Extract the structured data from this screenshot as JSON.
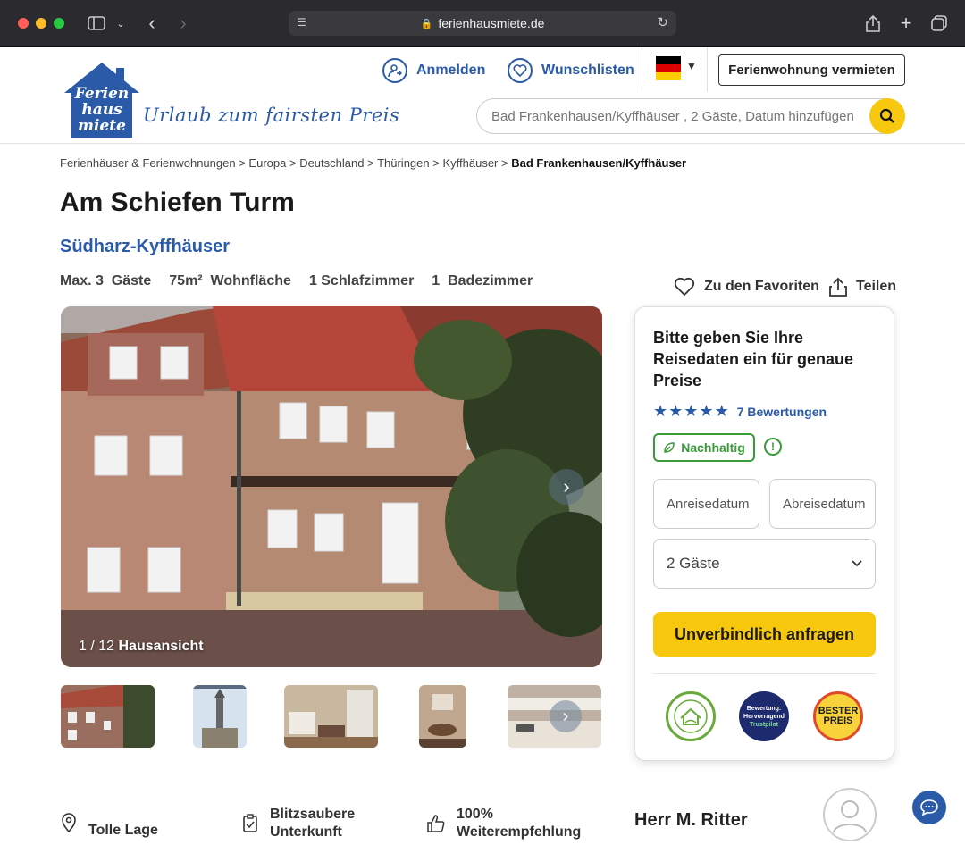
{
  "browser": {
    "url": "ferienhausmiete.de"
  },
  "header": {
    "logo_text": "Ferien haus miete",
    "tagline": "Urlaub zum fairsten Preis",
    "login_label": "Anmelden",
    "wishlist_label": "Wunschlisten",
    "rent_label": "Ferienwohnung vermieten",
    "search_placeholder": "Bad Frankenhausen/Kyffhäuser , 2 Gäste, Datum hinzufügen"
  },
  "breadcrumb": {
    "items": [
      "Ferienhäuser & Ferienwohnungen",
      "Europa",
      "Deutschland",
      "Thüringen",
      "Kyffhäuser"
    ],
    "separator": ">",
    "current": "Bad Frankenhausen/Kyffhäuser"
  },
  "listing": {
    "title": "Am Schiefen Turm",
    "region": "Südharz-Kyffhäuser",
    "facts": [
      "Max. 3  Gäste",
      "75m²  Wohnfläche",
      "1 Schlafzimmer",
      "1  Badezimmer"
    ],
    "favorite_label": "Zu den Favoriten",
    "share_label": "Teilen"
  },
  "gallery": {
    "counter": "1 / 12",
    "caption": "Hausansicht"
  },
  "booking": {
    "heading": "Bitte geben Sie Ihre Reisedaten ein für genaue Preise",
    "rating_stars": 5,
    "reviews_label": "7 Bewertungen",
    "eco_label": "Nachhaltig",
    "arrival_placeholder": "Anreisedatum",
    "departure_placeholder": "Abreisedatum",
    "guests_value": "2 Gäste",
    "cta_label": "Unverbindlich anfragen",
    "badges": {
      "trust_top": "Bewertung:",
      "trust_mid": "Hervorragend",
      "trust_bottom": "Trustpilot",
      "best_price_1": "BESTER",
      "best_price_2": "PREIS"
    }
  },
  "features": {
    "location": "Tolle Lage",
    "clean_1": "Blitzsaubere",
    "clean_2": "Unterkunft",
    "recommend_1": "100%",
    "recommend_2": "Weiterempfehlung"
  },
  "host": {
    "name": "Herr M. Ritter"
  },
  "colors": {
    "brand_blue": "#2a5aa8",
    "accent_yellow": "#f8c80f",
    "eco_green": "#3a9a3a"
  }
}
